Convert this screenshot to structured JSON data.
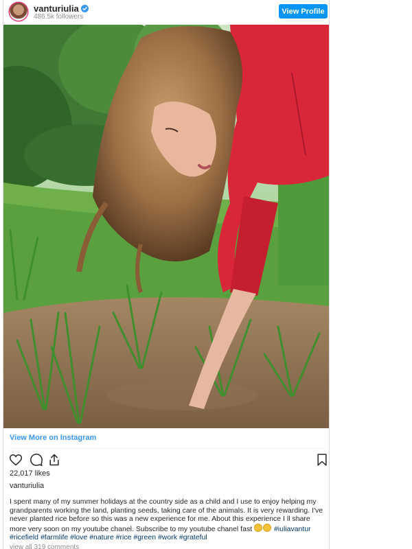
{
  "header": {
    "username": "vanturiulia",
    "followers": "486.5k followers",
    "view_profile_label": "View Profile"
  },
  "post": {
    "image_alt": "Woman in a red hoodie planting rice in a muddy paddy field",
    "view_more_label": "View More on Instagram",
    "likes": "22,017 likes",
    "caption_user": "vanturiulia",
    "caption_text": "I spent many of my summer holidays at the country side as a child and I use to enjoy helping my grandparents working the land, planting seeds, taking care of the animals. It is very rewarding. I've never planted rice before so this was a new experience for me. About this experience I ll share more very soon on my youtube chanel. Subscribe to my youtube chanel fast",
    "hashtags_line1": "#iuliavantur #ricefield",
    "hashtags_line2": "#farmlife #love #nature #rice #green #work #grateful",
    "view_comments": "view all 319 comments"
  },
  "icons": [
    "verified-badge-icon",
    "heart-icon",
    "comment-icon",
    "share-icon",
    "bookmark-icon",
    "smile-emoji-icon"
  ],
  "colors": {
    "accent": "#0095f6",
    "link": "#3897f0",
    "hashtag": "#00376b",
    "text": "#262626",
    "muted": "#8e8e8e"
  }
}
